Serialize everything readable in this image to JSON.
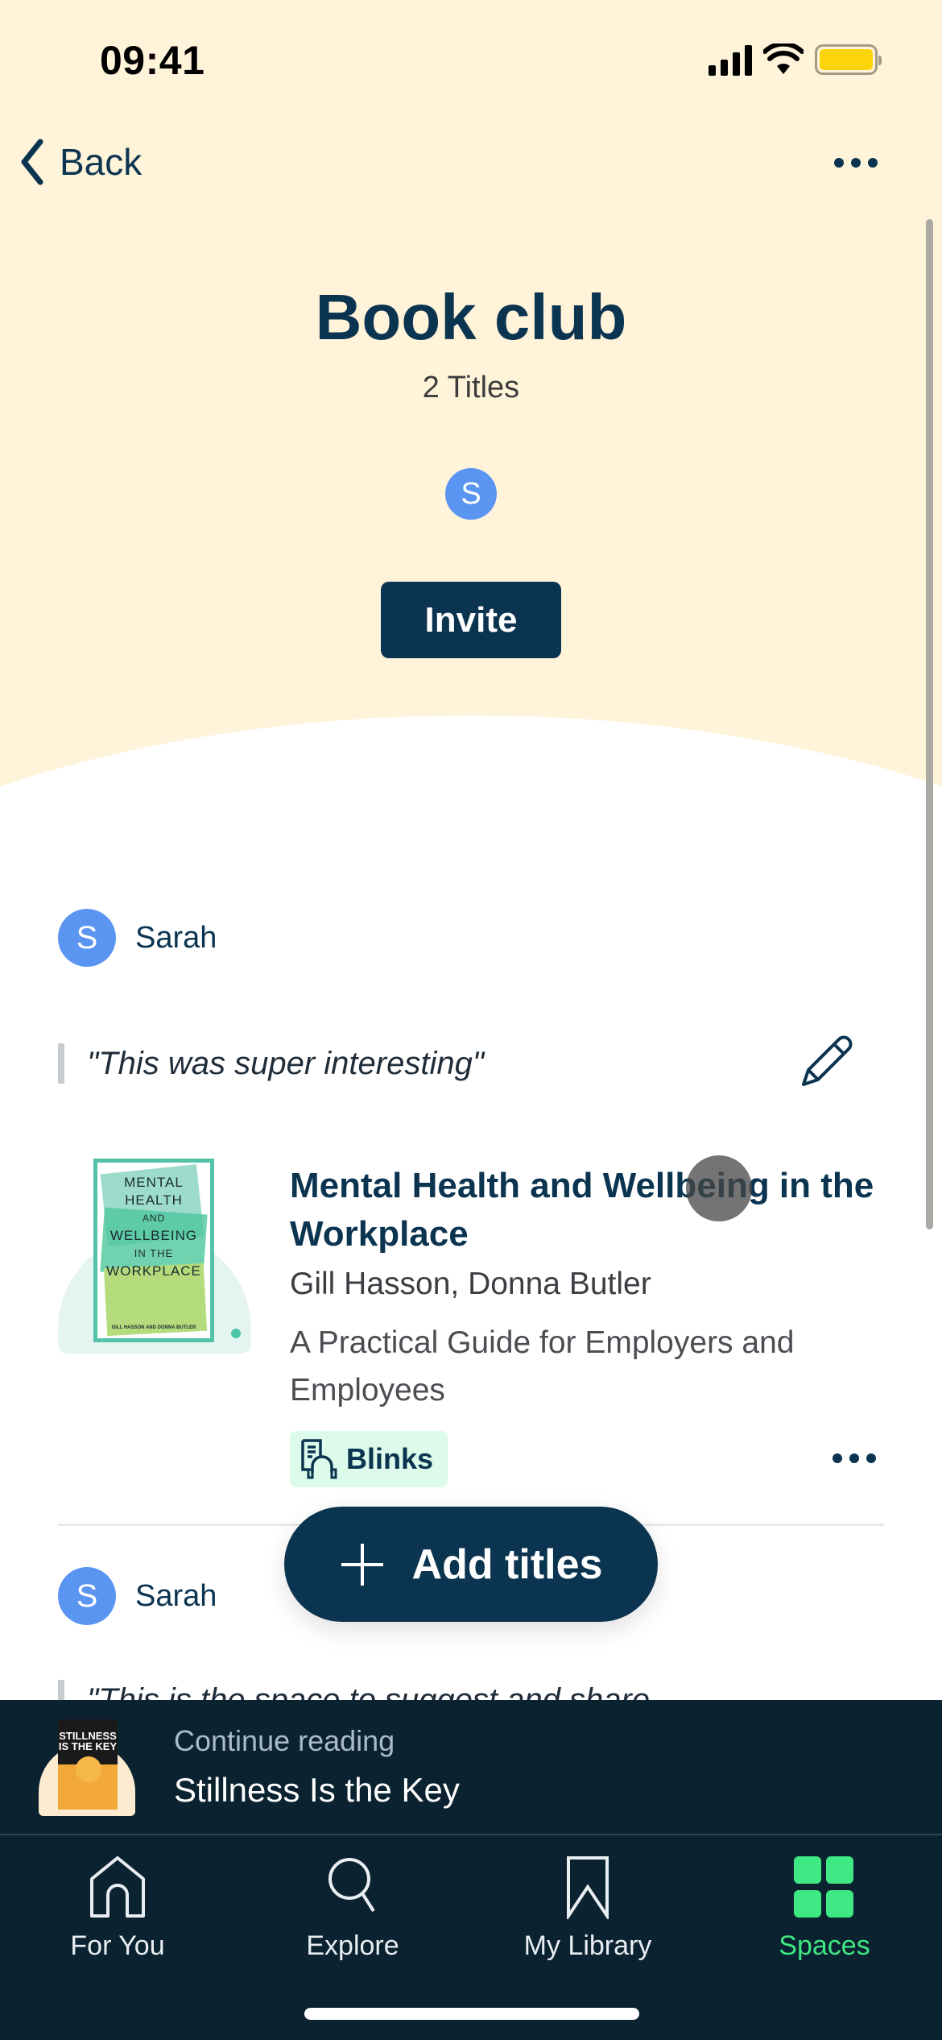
{
  "status_bar": {
    "time": "09:41",
    "battery_color": "#fbd40a"
  },
  "nav": {
    "back_label": "Back"
  },
  "header": {
    "title": "Book club",
    "subtitle": "2 Titles",
    "member_initial": "S",
    "invite_label": "Invite"
  },
  "entries": [
    {
      "user_initial": "S",
      "user_name": "Sarah",
      "quote": "\"This was super interesting\"",
      "book": {
        "cover_lines": [
          "MENTAL",
          "HEALTH",
          "AND",
          "WELLBEING",
          "IN THE",
          "WORKPLACE"
        ],
        "cover_authors": "GILL HASSON AND DONNA BUTLER",
        "title": "Mental Health and Wellbeing in the Workplace",
        "authors": "Gill Hasson, Donna Butler",
        "subtitle": "A Practical Guide for Employers and Employees",
        "format_badge": "Blinks"
      }
    },
    {
      "user_initial": "S",
      "user_name": "Sarah",
      "quote": "\"This is the space to suggest and share"
    }
  ],
  "fab": {
    "label": "Add titles"
  },
  "continue_reading": {
    "label": "Continue reading",
    "title": "Stillness Is the Key",
    "cover_text": "STILLNESS IS THE KEY"
  },
  "tabs": [
    {
      "label": "For You",
      "icon": "home-icon",
      "active": false
    },
    {
      "label": "Explore",
      "icon": "search-icon",
      "active": false
    },
    {
      "label": "My Library",
      "icon": "bookmark-icon",
      "active": false
    },
    {
      "label": "Spaces",
      "icon": "grid-icon",
      "active": true
    }
  ],
  "colors": {
    "primary": "#0b3450",
    "header_bg": "#fff3da",
    "avatar": "#5b95f2",
    "active_tab": "#3ee882",
    "badge_bg": "#dcfbeb",
    "dark_bar": "#0b2230"
  }
}
